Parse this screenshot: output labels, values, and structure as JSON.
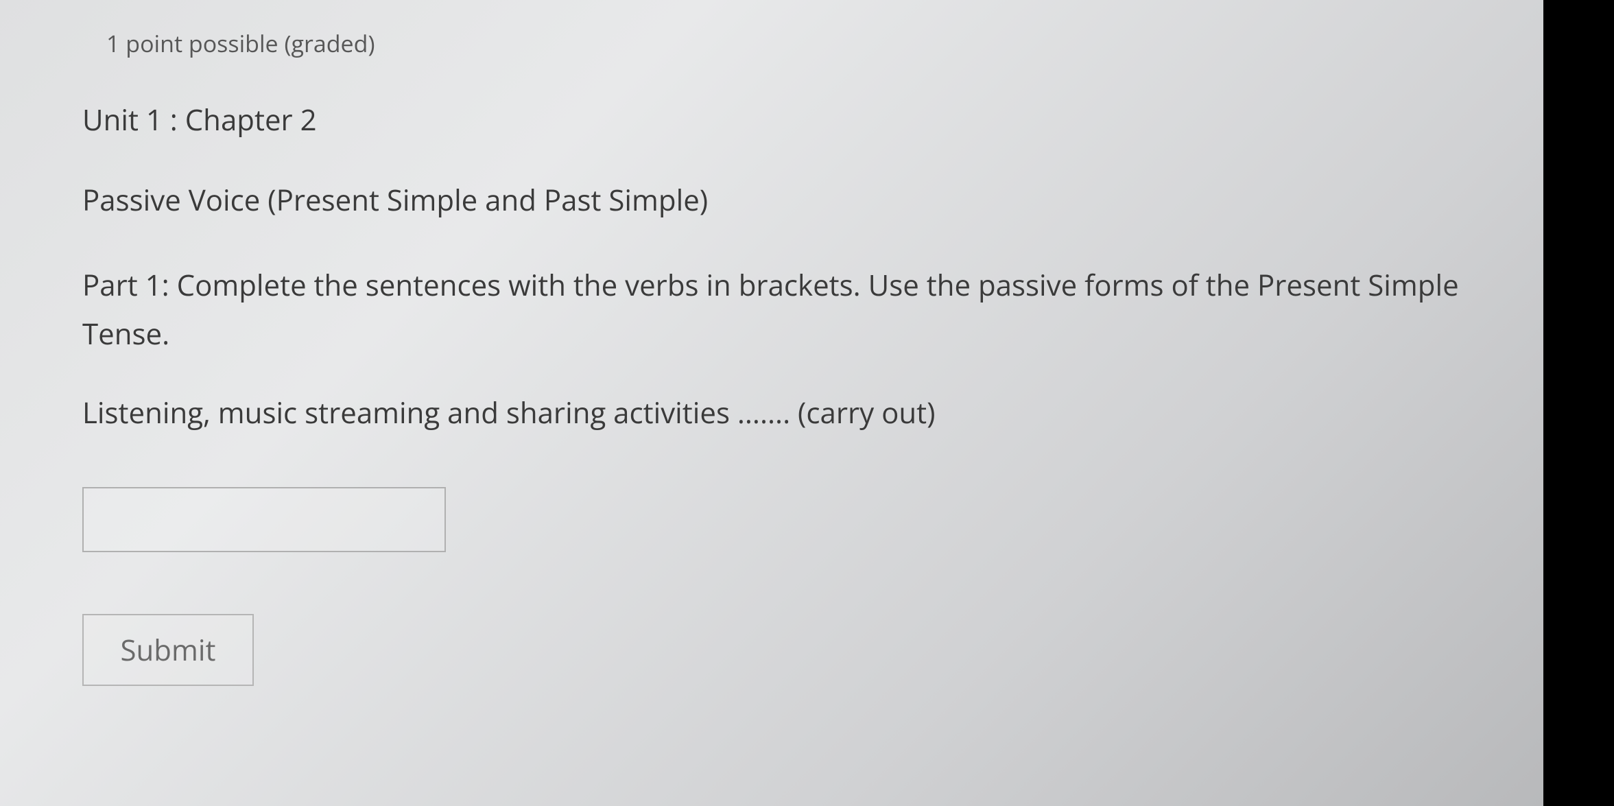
{
  "header": {
    "points_label": "1 point possible (graded)"
  },
  "content": {
    "unit_title": "Unit 1 : Chapter 2",
    "topic_title": "Passive Voice (Present Simple and Past Simple)",
    "instructions": "Part 1: Complete the sentences with the verbs in brackets. Use the passive forms of the Present Simple Tense.",
    "question_text": "Listening, music streaming and sharing activities ....... (carry out)"
  },
  "form": {
    "answer_value": "",
    "submit_label": "Submit"
  }
}
